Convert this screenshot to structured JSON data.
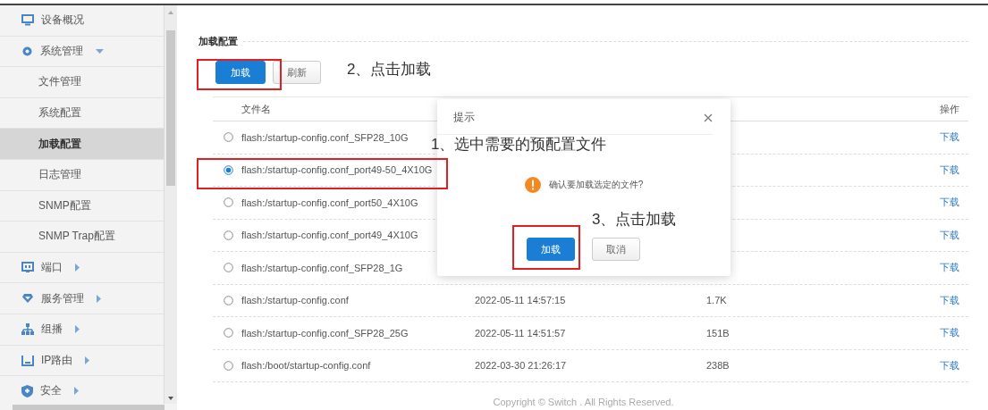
{
  "sidebar": {
    "items": [
      {
        "kind": "group",
        "label": "设备概况"
      },
      {
        "kind": "group",
        "label": "系统管理",
        "expanded": true
      },
      {
        "kind": "sub",
        "label": "文件管理",
        "selected": false
      },
      {
        "kind": "sub",
        "label": "系统配置",
        "selected": false
      },
      {
        "kind": "sub",
        "label": "加载配置",
        "selected": true
      },
      {
        "kind": "sub",
        "label": "日志管理",
        "selected": false
      },
      {
        "kind": "sub",
        "label": "SNMP配置",
        "selected": false
      },
      {
        "kind": "sub",
        "label": "SNMP Trap配置",
        "selected": false
      },
      {
        "kind": "group",
        "label": "端口",
        "expanded": false
      },
      {
        "kind": "group",
        "label": "服务管理",
        "expanded": false
      },
      {
        "kind": "group",
        "label": "组播",
        "expanded": false
      },
      {
        "kind": "group",
        "label": "IP路由",
        "expanded": false
      },
      {
        "kind": "group",
        "label": "安全",
        "expanded": false
      }
    ]
  },
  "section_title": "加载配置",
  "toolbar": {
    "buttons": [
      {
        "label": "加载",
        "kind": "primary"
      },
      {
        "label": "刷新",
        "kind": "default"
      }
    ]
  },
  "table": {
    "columns": [
      "文件名",
      "操作"
    ],
    "rows": [
      {
        "name": "flash:/startup-config.conf_SFP28_10G",
        "selected": false,
        "action": "下载"
      },
      {
        "name": "flash:/startup-config.conf_port49-50_4X10G",
        "selected": true,
        "action": "下载"
      },
      {
        "name": "flash:/startup-config.conf_port50_4X10G",
        "selected": false,
        "action": "下载"
      },
      {
        "name": "flash:/startup-config.conf_port49_4X10G",
        "selected": false,
        "action": "下载"
      },
      {
        "name": "flash:/startup-config.conf_SFP28_1G",
        "selected": false,
        "action": "下载"
      },
      {
        "name": "flash:/startup-config.conf",
        "selected": false,
        "date": "2022-05-11 14:57:15",
        "size": "1.7K",
        "action": "下载"
      },
      {
        "name": "flash:/startup-config.conf_SFP28_25G",
        "selected": false,
        "date": "2022-05-11 14:51:57",
        "size": "151B",
        "action": "下载"
      },
      {
        "name": "flash:/boot/startup-config.conf",
        "selected": false,
        "date": "2022-03-30 21:26:17",
        "size": "238B",
        "action": "下载"
      }
    ]
  },
  "footer": "Copyright © Switch . All Rights Reserved.",
  "dialog": {
    "title": "提示",
    "message": "确认要加载选定的文件?",
    "buttons": [
      {
        "label": "加载",
        "kind": "primary"
      },
      {
        "label": "取消",
        "kind": "default"
      }
    ]
  },
  "annotations": [
    {
      "text": "2、点击加载"
    },
    {
      "text": "1、选中需要的预配置文件"
    },
    {
      "text": "3、点击加载"
    }
  ]
}
